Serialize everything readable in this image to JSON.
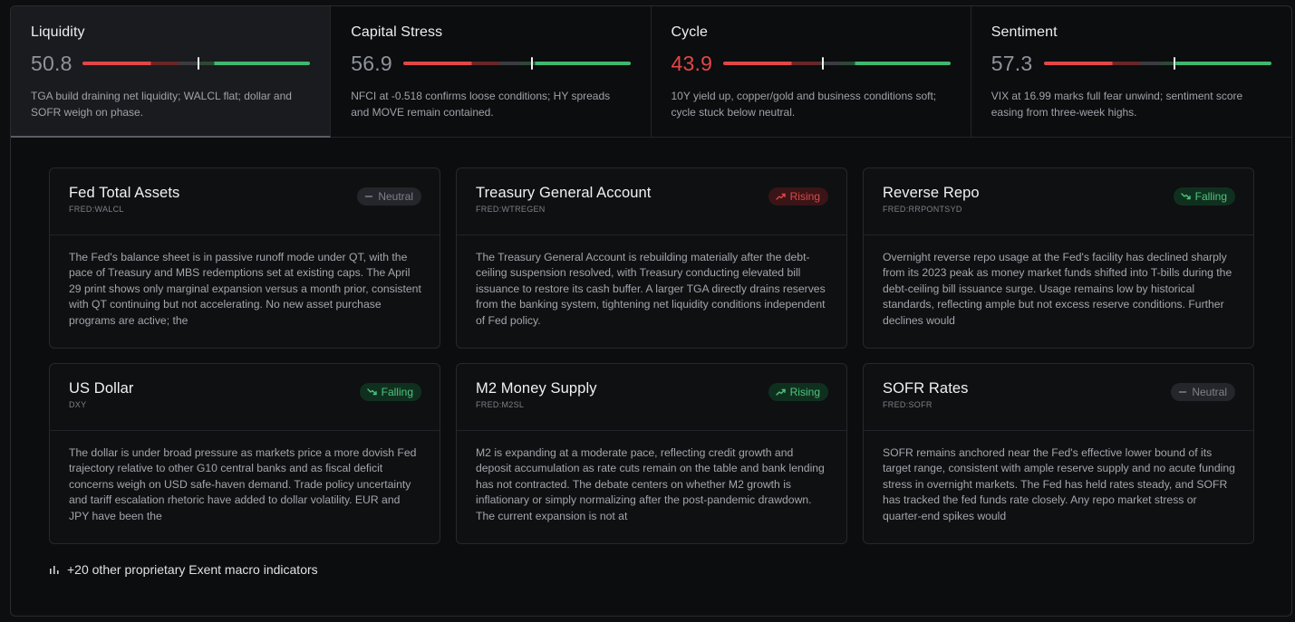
{
  "metrics": [
    {
      "title": "Liquidity",
      "value": "50.8",
      "marker": 0.508,
      "desc": "TGA build draining net liquidity; WALCL flat; dollar and SOFR weigh on phase."
    },
    {
      "title": "Capital Stress",
      "value": "56.9",
      "marker": 0.569,
      "desc": "NFCI at -0.518 confirms loose conditions; HY spreads and MOVE remain contained."
    },
    {
      "title": "Cycle",
      "value": "43.9",
      "marker": 0.439,
      "desc": "10Y yield up, copper/gold and business conditions soft; cycle stuck below neutral."
    },
    {
      "title": "Sentiment",
      "value": "57.3",
      "marker": 0.573,
      "desc": "VIX at 16.99 marks full fear unwind; sentiment score easing from three-week highs."
    }
  ],
  "cards": [
    {
      "title": "Fed Total Assets",
      "code": "FRED:WALCL",
      "badge": "Neutral",
      "body": "The Fed's balance sheet is in passive runoff mode under QT, with the pace of Treasury and MBS redemptions set at existing caps. The April 29 print shows only marginal expansion versus a month prior, consistent with QT continuing but not accelerating. No new asset purchase programs are active; the"
    },
    {
      "title": "Treasury General Account",
      "code": "FRED:WTREGEN",
      "badge": "Rising",
      "body": "The Treasury General Account is rebuilding materially after the debt-ceiling suspension resolved, with Treasury conducting elevated bill issuance to restore its cash buffer. A larger TGA directly drains reserves from the banking system, tightening net liquidity conditions independent of Fed policy."
    },
    {
      "title": "Reverse Repo",
      "code": "FRED:RRPONTSYD",
      "badge": "Falling",
      "body": "Overnight reverse repo usage at the Fed's facility has declined sharply from its 2023 peak as money market funds shifted into T-bills during the debt-ceiling bill issuance surge. Usage remains low by historical standards, reflecting ample but not excess reserve conditions. Further declines would"
    },
    {
      "title": "US Dollar",
      "code": "DXY",
      "badge": "Falling",
      "body": "The dollar is under broad pressure as markets price a more dovish Fed trajectory relative to other G10 central banks and as fiscal deficit concerns weigh on USD safe-haven demand. Trade policy uncertainty and tariff escalation rhetoric have added to dollar volatility. EUR and JPY have been the"
    },
    {
      "title": "M2 Money Supply",
      "code": "FRED:M2SL",
      "badge": "Rising",
      "body": "M2 is expanding at a moderate pace, reflecting credit growth and deposit accumulation as rate cuts remain on the table and bank lending has not contracted. The debate centers on whether M2 growth is inflationary or simply normalizing after the post-pandemic drawdown. The current expansion is not at"
    },
    {
      "title": "SOFR Rates",
      "code": "FRED:SOFR",
      "badge": "Neutral",
      "body": "SOFR remains anchored near the Fed's effective lower bound of its target range, consistent with ample reserve supply and no acute funding stress in overnight markets. The Fed has held rates steady, and SOFR has tracked the fed funds rate closely. Any repo market stress or quarter-end spikes would"
    }
  ],
  "footer": {
    "text": "+20 other proprietary Exent macro indicators",
    "icon": "bar-chart-icon"
  },
  "colors": {
    "red": "#e24747",
    "green": "#3fb86f",
    "neutral": "#7d8188"
  }
}
